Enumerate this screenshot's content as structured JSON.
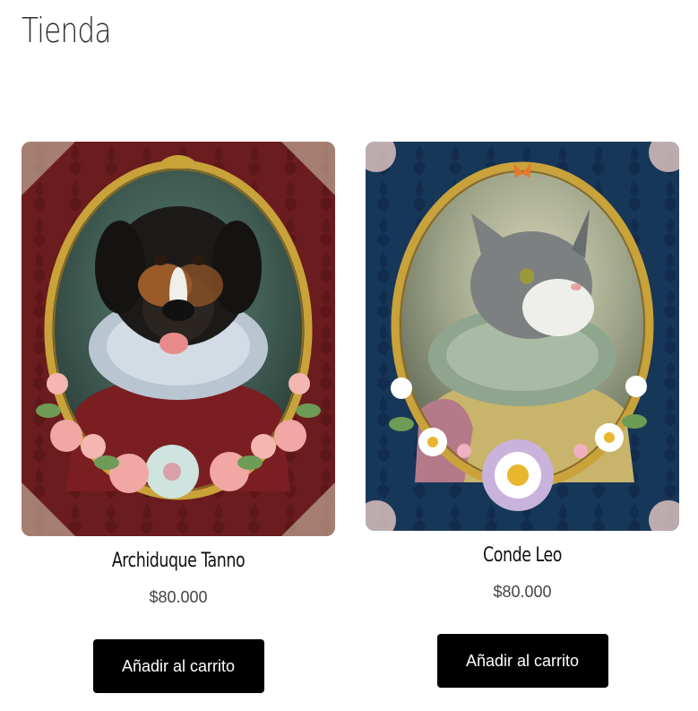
{
  "page": {
    "title": "Tienda"
  },
  "products": [
    {
      "name": "Archiduque Tanno",
      "price": "$80.000",
      "button_label": "Añadir al carrito",
      "image_alt": "Retrato de perro con gorguera en marco dorado ovalado sobre fondo rojo",
      "background_color": "#6e1f1f",
      "accent_color": "#c9a23a"
    },
    {
      "name": "Conde Leo",
      "price": "$80.000",
      "button_label": "Añadir al carrito",
      "image_alt": "Retrato de gato con gorguera verde en marco dorado ovalado sobre fondo azul",
      "background_color": "#17375a",
      "accent_color": "#c9a23a"
    }
  ]
}
